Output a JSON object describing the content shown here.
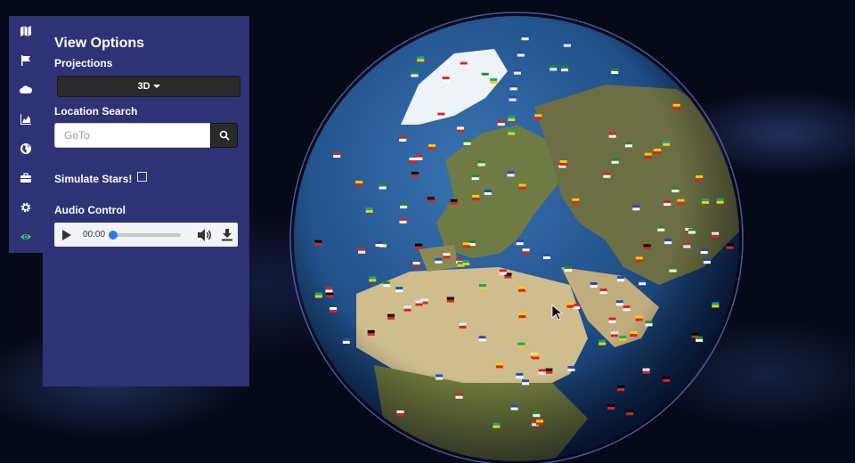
{
  "panel": {
    "title": "View Options",
    "projections_label": "Projections",
    "projection_value": "3D",
    "location_search_label": "Location Search",
    "search_placeholder": "GoTo",
    "simulate_stars_label": "Simulate Stars!",
    "simulate_stars_checked": false,
    "audio_control_label": "Audio Control",
    "audio_time": "00:00",
    "audio_progress": 0
  },
  "rail": {
    "items": [
      {
        "icon": "map-icon"
      },
      {
        "icon": "flag-icon"
      },
      {
        "icon": "cloud-icon"
      },
      {
        "icon": "area-chart-icon"
      },
      {
        "icon": "globe-icon"
      },
      {
        "icon": "briefcase-icon"
      },
      {
        "icon": "gear-icon"
      },
      {
        "icon": "eye-icon",
        "active": true
      }
    ]
  },
  "colors": {
    "panel_bg": "#2e3376",
    "active_icon": "#3ecf6e",
    "ocean": "#1e4f86",
    "land": "#7b7d4f",
    "desert": "#c8b78a"
  }
}
